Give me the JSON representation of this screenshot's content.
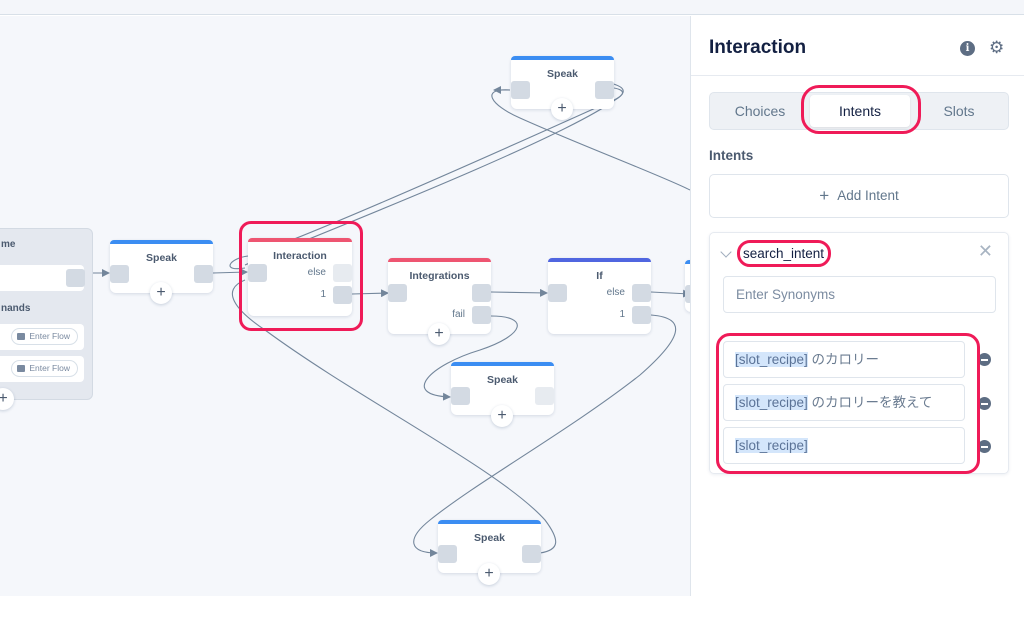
{
  "panel": {
    "title": "Interaction",
    "icons": {
      "info": "info-icon",
      "settings": "gear-icon"
    },
    "tabs": [
      {
        "label": "Choices",
        "active": false
      },
      {
        "label": "Intents",
        "active": true
      },
      {
        "label": "Slots",
        "active": false
      }
    ],
    "section_label": "Intents",
    "add_intent_label": "Add Intent",
    "intent": {
      "name": "search_intent",
      "synonyms_placeholder": "Enter Synonyms",
      "utterances": [
        {
          "slot": "[slot_recipe]",
          "text": " のカロリー"
        },
        {
          "slot": "[slot_recipe]",
          "text": " のカロリーを教えて"
        },
        {
          "slot": "[slot_recipe]",
          "text": ""
        }
      ]
    }
  },
  "canvas": {
    "start_block": {
      "section1": "me",
      "section2": "nands",
      "commands": [
        {
          "button": "Enter Flow"
        },
        {
          "button": "Enter Flow"
        }
      ]
    },
    "nodes": {
      "speak_1": {
        "title": "Speak"
      },
      "interaction": {
        "title": "Interaction",
        "ports": [
          "else",
          "1"
        ]
      },
      "integrations": {
        "title": "Integrations",
        "ports": [
          "fail"
        ]
      },
      "if": {
        "title": "If",
        "ports": [
          "else",
          "1"
        ]
      },
      "speak_top": {
        "title": "Speak"
      },
      "speak_mid": {
        "title": "Speak"
      },
      "speak_bottom": {
        "title": "Speak"
      }
    },
    "colors": {
      "speak": "#3b8df2",
      "interaction": "#ee5571",
      "integrations": "#ee5571",
      "if": "#5066e0",
      "highlight": "#ef1b58"
    },
    "add_symbol": "+"
  }
}
